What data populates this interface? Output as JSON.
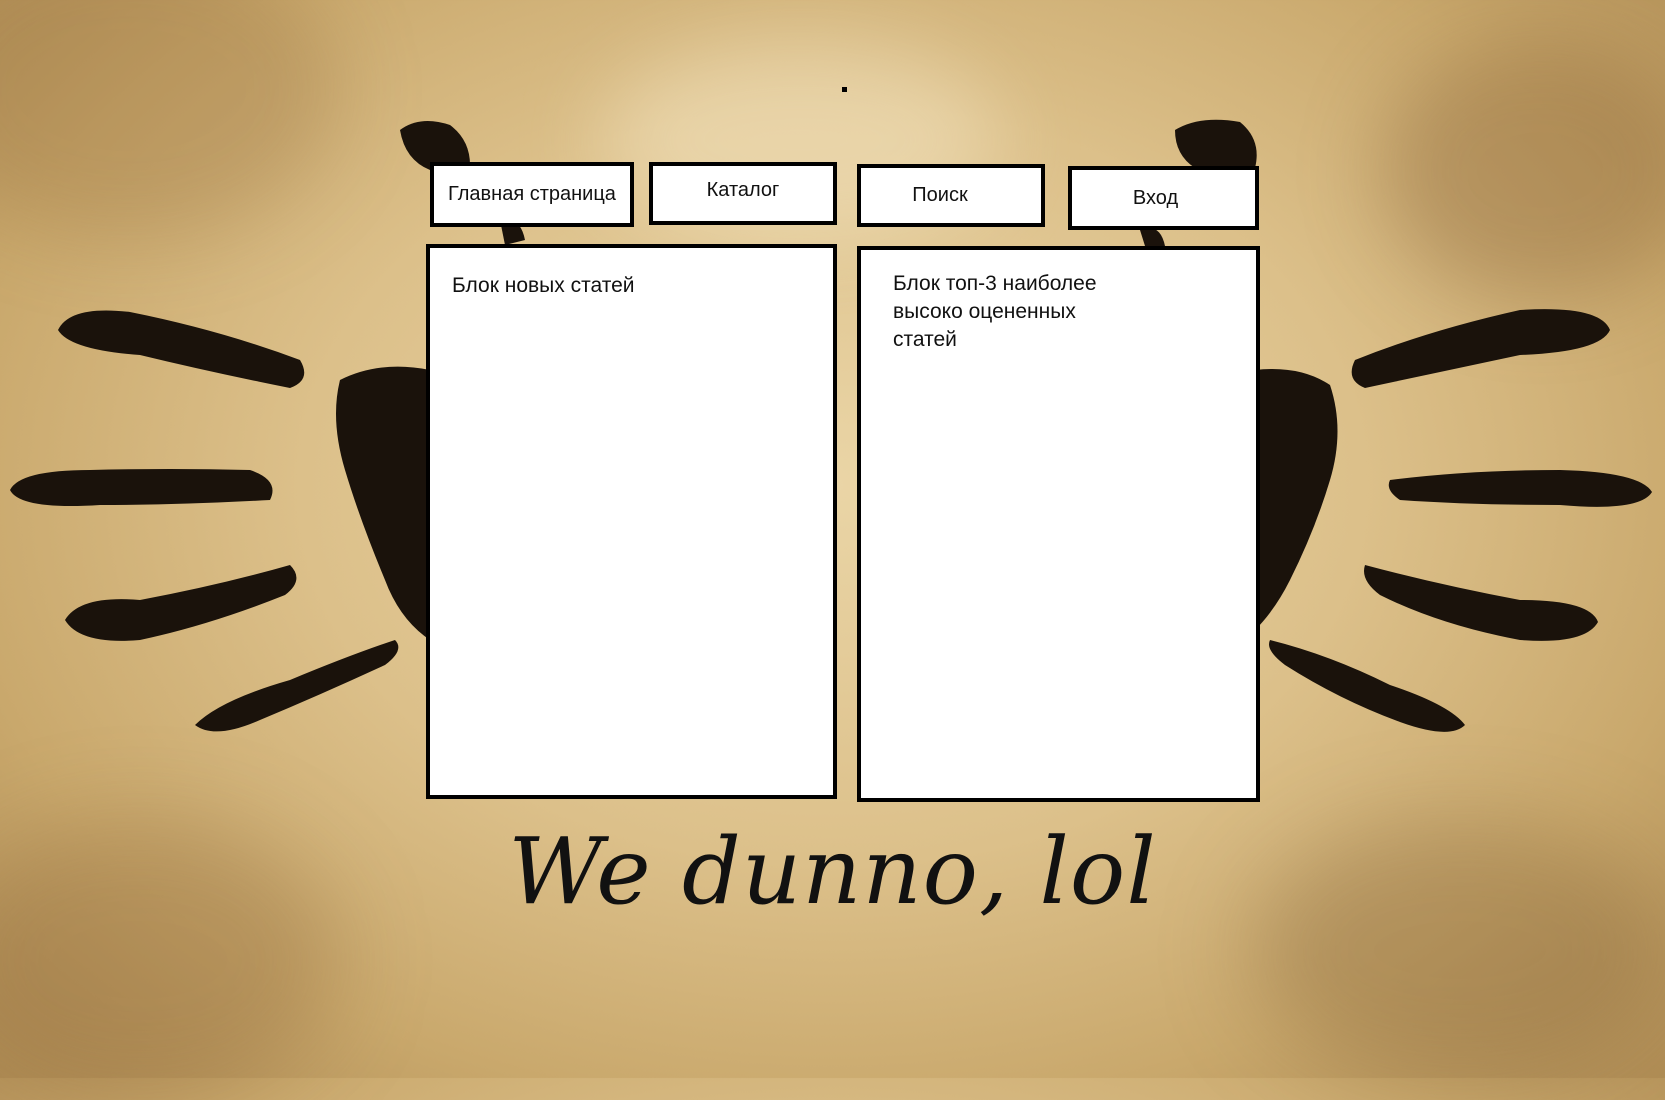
{
  "nav": {
    "home_label": "Главная страница",
    "catalog_label": "Каталог",
    "search_label": "Поиск",
    "login_label": "Вход"
  },
  "panels": {
    "new_articles_label": "Блок новых статей",
    "top_rated_label": "Блок топ-3 наиболее высоко оцененных статей"
  },
  "slogan": "We dunno, lol",
  "colors": {
    "parchment": "#e3c994",
    "ink": "#111111",
    "panel_bg": "#ffffff"
  }
}
